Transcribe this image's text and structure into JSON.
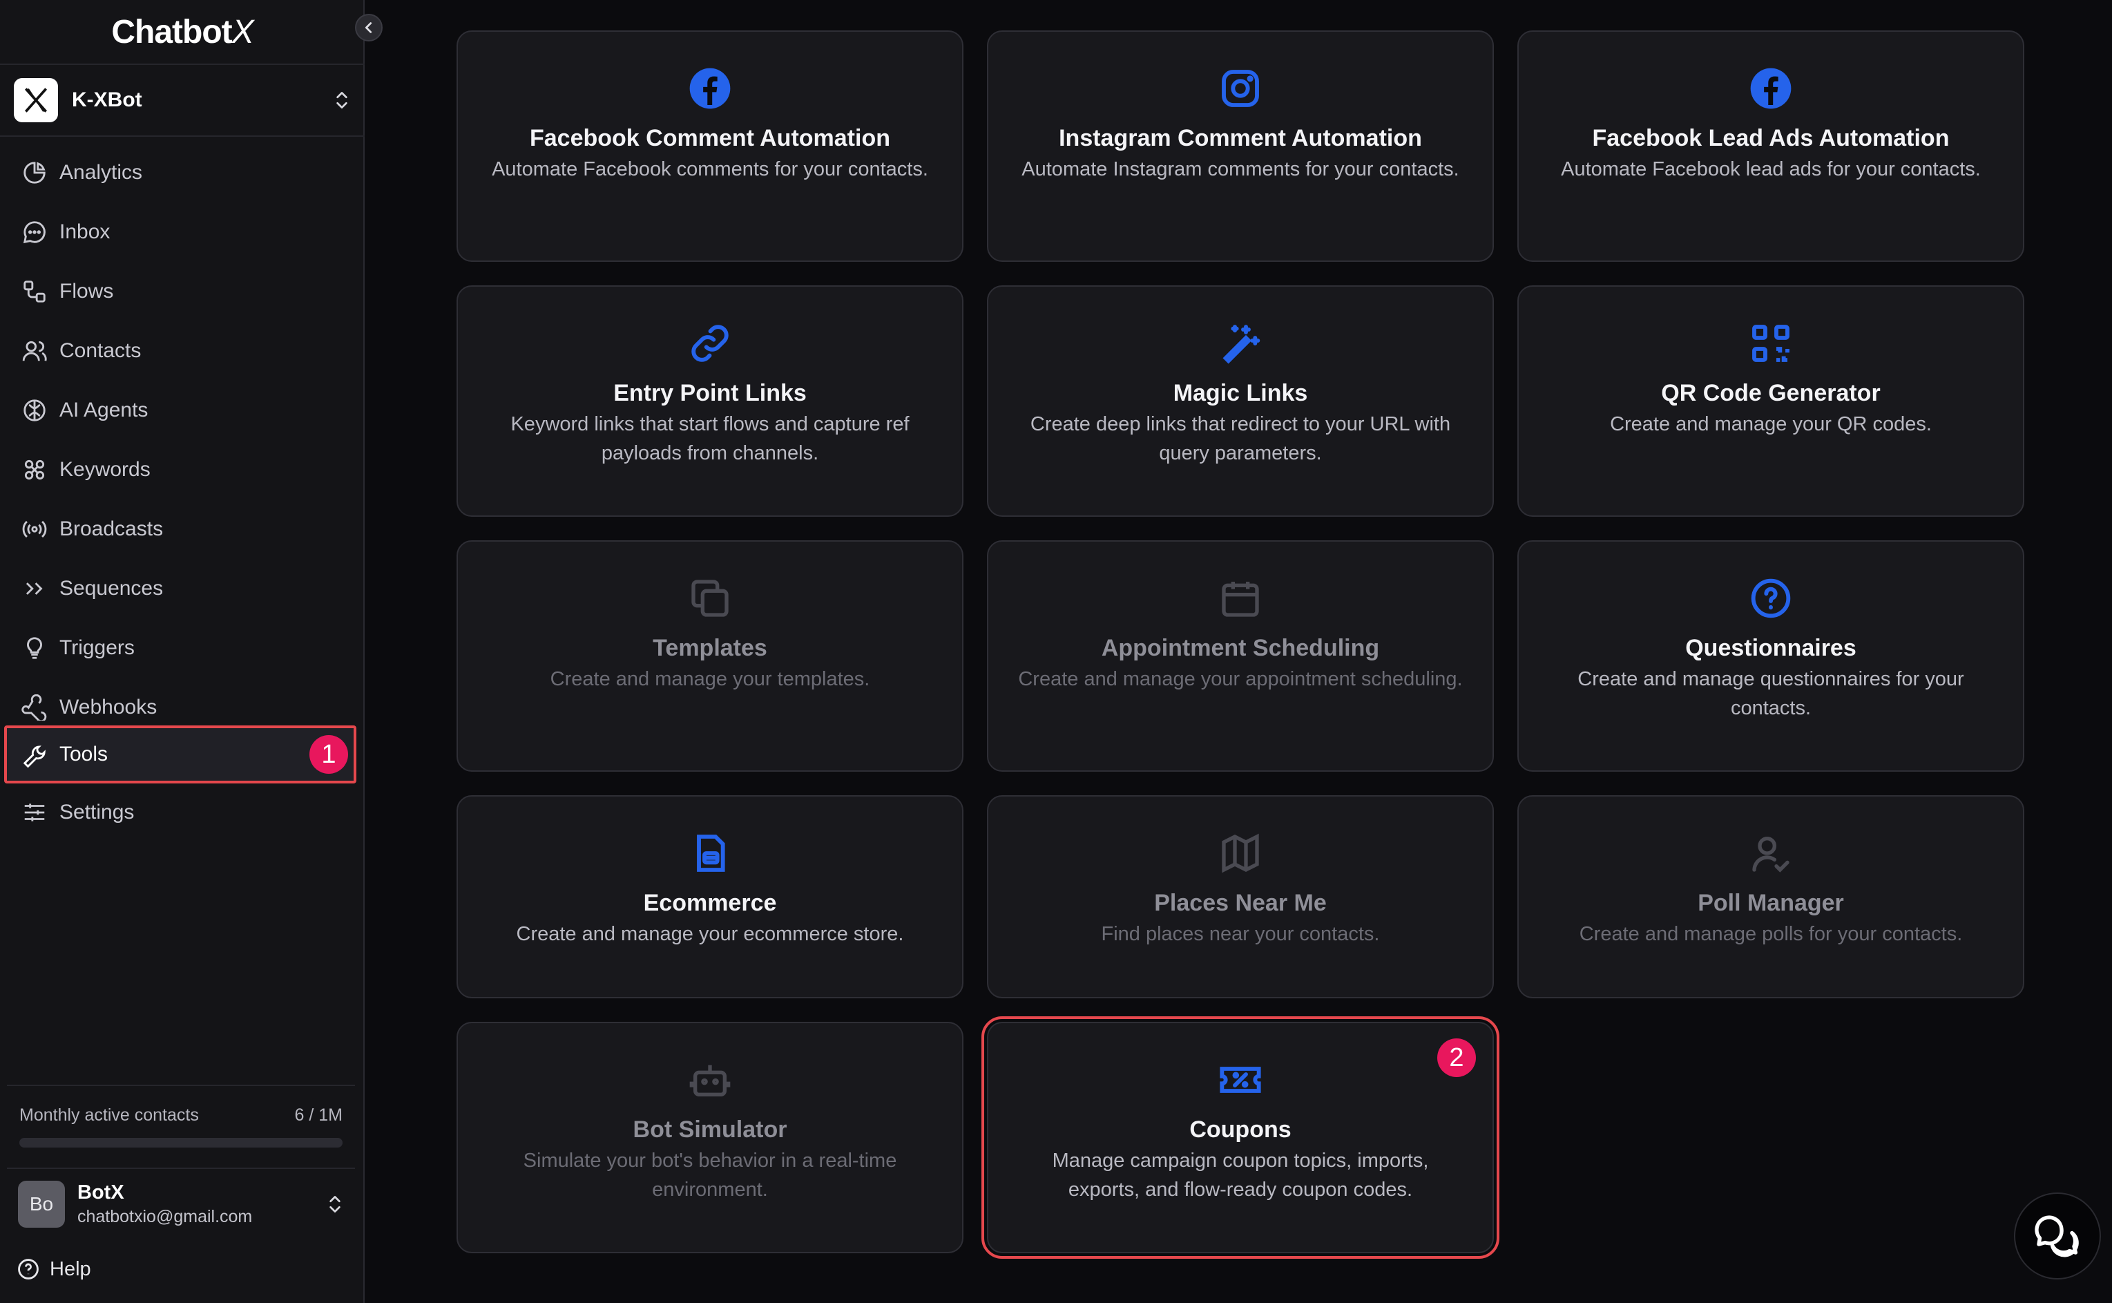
{
  "app": {
    "logo": "Chatbot",
    "logo_x": "X"
  },
  "bot": {
    "name": "K-XBot"
  },
  "nav": {
    "analytics": "Analytics",
    "inbox": "Inbox",
    "flows": "Flows",
    "contacts": "Contacts",
    "ai_agents": "AI Agents",
    "keywords": "Keywords",
    "broadcasts": "Broadcasts",
    "sequences": "Sequences",
    "triggers": "Triggers",
    "webhooks": "Webhooks",
    "tools": "Tools",
    "settings": "Settings",
    "active": "Tools"
  },
  "usage": {
    "label": "Monthly active contacts",
    "value": "6 / 1M",
    "fraction": 6e-06
  },
  "user": {
    "initials": "Bo",
    "name": "BotX",
    "email": "chatbotxio@gmail.com"
  },
  "help": "Help",
  "annotations": {
    "tools_badge": "1",
    "coupons_badge": "2"
  },
  "colors": {
    "accent_blue": "#2563eb",
    "highlight_red": "#e5484d",
    "badge_pink": "#e8175d"
  },
  "cards": {
    "fb_comment": {
      "title": "Facebook Comment Automation",
      "desc": "Automate Facebook comments for your contacts.",
      "icon": "facebook-icon"
    },
    "ig_comment": {
      "title": "Instagram Comment Automation",
      "desc": "Automate Instagram comments for your contacts.",
      "icon": "instagram-icon"
    },
    "fb_lead": {
      "title": "Facebook Lead Ads Automation",
      "desc": "Automate Facebook lead ads for your contacts.",
      "icon": "facebook-icon"
    },
    "entry_links": {
      "title": "Entry Point Links",
      "desc": "Keyword links that start flows and capture ref payloads from channels.",
      "icon": "link-icon"
    },
    "magic_links": {
      "title": "Magic Links",
      "desc": "Create deep links that redirect to your URL with query parameters.",
      "icon": "magic-wand-icon"
    },
    "qr_code": {
      "title": "QR Code Generator",
      "desc": "Create and manage your QR codes.",
      "icon": "qr-code-icon"
    },
    "templates": {
      "title": "Templates",
      "desc": "Create and manage your templates.",
      "icon": "copy-icon"
    },
    "appointment": {
      "title": "Appointment Scheduling",
      "desc": "Create and manage your appointment scheduling.",
      "icon": "calendar-icon"
    },
    "questionnaires": {
      "title": "Questionnaires",
      "desc": "Create and manage questionnaires for your contacts.",
      "icon": "question-circle-icon"
    },
    "ecommerce": {
      "title": "Ecommerce",
      "desc": "Create and manage your ecommerce store.",
      "icon": "store-icon"
    },
    "places": {
      "title": "Places Near Me",
      "desc": "Find places near your contacts.",
      "icon": "map-icon"
    },
    "poll": {
      "title": "Poll Manager",
      "desc": "Create and manage polls for your contacts.",
      "icon": "user-check-icon"
    },
    "bot_sim": {
      "title": "Bot Simulator",
      "desc": "Simulate your bot's behavior in a real-time environment.",
      "icon": "robot-icon"
    },
    "coupons": {
      "title": "Coupons",
      "desc": "Manage campaign coupon topics, imports, exports, and flow-ready coupon codes.",
      "icon": "ticket-percent-icon"
    }
  }
}
